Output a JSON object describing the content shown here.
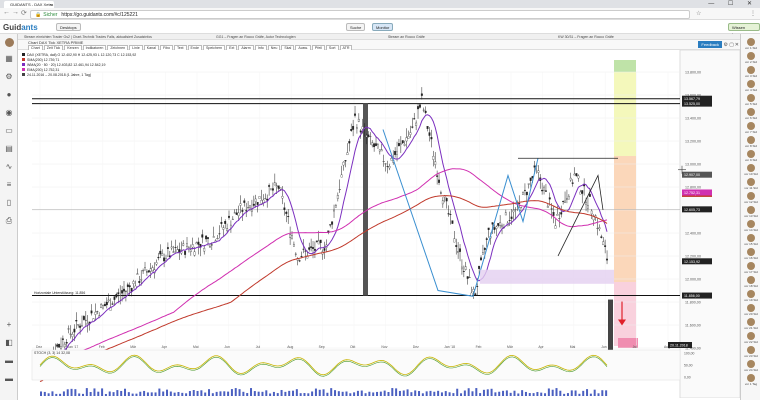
{
  "browser": {
    "tab_title": "GUIDANTS - DAX Xetra",
    "tab_close": "×",
    "window_controls": "— ☐ ✕",
    "back": "←",
    "forward": "→",
    "reload": "⟳",
    "lock": "🔒",
    "secure_label": "Sicher",
    "url": "https://go.guidants.com/#c/125221",
    "star": "☆",
    "menu": "⋮"
  },
  "app": {
    "logo_text": "Guid",
    "logo_accent": "ants",
    "desktop_label": "Desktops",
    "search_label": "Suche",
    "monitor_label": "Monitor",
    "premium_label": "Wissen Logon"
  },
  "streams": [
    "Stream einrichten Trader Gs2 | Chart-Technik Trades Falls, aktualisiert Zusatzinfos",
    "GG1 – Fragen an Rocco Gräfe, Autor Technologien",
    "Stream an Rocco Gräfe",
    "KW 30/31 – Fragen an Rocco Gräfe"
  ],
  "tool": {
    "header": "Chart DAX Tick XETRA PRIME",
    "buttons": [
      "Chart",
      "Zeit Tick",
      "Kerzen",
      "Indikatoren",
      "Zeichnen",
      "Linie",
      "Kanal",
      "Fibo",
      "Text",
      "Ende",
      "Speichern",
      "Ext",
      "Alarm",
      "Info",
      "Neu",
      "Skal",
      "Ausw.",
      "Pfeil",
      "Sort",
      "ATR"
    ],
    "feedback_label": "Feedback"
  },
  "chart_data": {
    "type": "line",
    "instrument": "DAX (XETRA, dail)",
    "legend": [
      {
        "label": "DAX (XETRA, dail) O 12.402,90  H 12.425,93  L 12.120,73  C 12.153,92",
        "color": "#222222"
      },
      {
        "label": "SMA(200)  12.739,71",
        "color": "#c0392b"
      },
      {
        "label": "WMA(20 · 50 · 20)  12.403,82  12.461,94  12.542,19",
        "color": "#7b2fbf"
      },
      {
        "label": "EMA(200)  12.752,31",
        "color": "#d02fb0"
      },
      {
        "label": "24.11.2016 – 20.08.2018  (1 Jahre, 1 Tag)",
        "color": "#444444"
      }
    ],
    "x_ticks": [
      "Dez",
      "Jan '17",
      "Feb",
      "Mär",
      "Apr",
      "Mai",
      "Jun",
      "Jul",
      "Aug",
      "Sep",
      "Okt",
      "Nov",
      "Dez",
      "Jan '18",
      "Feb",
      "Mär",
      "Apr",
      "Mai",
      "Jun",
      "Jul",
      "Aug"
    ],
    "y_ticks": [
      "13.800,00",
      "13.600,00",
      "13.400,00",
      "13.200,00",
      "13.000,00",
      "12.800,00",
      "12.600,00",
      "12.400,00",
      "12.200,00",
      "12.000,00",
      "11.800,00",
      "11.600,00",
      "11.400,00"
    ],
    "price_labels": [
      {
        "text": "13.567,79",
        "color": "#222222",
        "price": 13567.79
      },
      {
        "text": "13.525,00",
        "color": "#222222",
        "price": 13525
      },
      {
        "text": "12.907,00",
        "color": "#555555",
        "price": 12907
      },
      {
        "text": "12.739,71",
        "color": "#c0392b",
        "price": 12739.71
      },
      {
        "text": "12.752,31",
        "color": "#d02fb0",
        "price": 12752.31
      },
      {
        "text": "12.605,73",
        "color": "#222222",
        "price": 12605.73
      },
      {
        "text": "12.153,92",
        "color": "#222222",
        "price": 12153.92
      },
      {
        "text": "11.856,00",
        "color": "#222222",
        "price": 11856
      }
    ],
    "annotation_support": "Horizontale Unterstützung: 11.856",
    "date_tag": "20.11.2018",
    "sub_indicator_label": "STOCH (3, 3) 14  32,08",
    "sub_y_ticks": [
      "100,00",
      "50,00",
      "0,00"
    ],
    "colors": {
      "price": "#222222",
      "sma": "#c0392b",
      "wma": "#7b2fbf",
      "ema": "#d02fb0",
      "stoch": "#c8b400",
      "zigzag": "#3a8fd0"
    }
  },
  "right_panel": [
    {
      "time": "vor 1 Std"
    },
    {
      "time": "vor 2 Std"
    },
    {
      "time": "vor 3 Std"
    },
    {
      "time": "vor 4 Std"
    },
    {
      "time": "vor 5 Std"
    },
    {
      "time": "vor 6 Std"
    },
    {
      "time": "vor 7 Std"
    },
    {
      "time": "vor 8 Std"
    },
    {
      "time": "vor 9 Std"
    },
    {
      "time": "vor 10 Std"
    },
    {
      "time": "vor 11 Std"
    },
    {
      "time": "vor 12 Std"
    },
    {
      "time": "vor 13 Std"
    },
    {
      "time": "vor 14 Std"
    },
    {
      "time": "vor 15 Std"
    },
    {
      "time": "vor 16 Std"
    },
    {
      "time": "vor 17 Std"
    },
    {
      "time": "vor 18 Std"
    },
    {
      "time": "vor 19 Std"
    },
    {
      "time": "vor 20 Std"
    },
    {
      "time": "vor 21 Std"
    },
    {
      "time": "vor 22 Std"
    },
    {
      "time": "vor 23 Std"
    },
    {
      "time": "vor 24 Std"
    },
    {
      "time": "vor 1 Tag"
    }
  ]
}
